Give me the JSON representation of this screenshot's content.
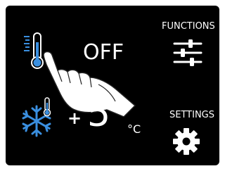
{
  "display": {
    "status": "OFF",
    "temperature": {
      "sign": "+",
      "value": "5",
      "unit": "°C"
    }
  },
  "menu": {
    "functions_label": "FUNCTIONS",
    "settings_label": "SETTINGS"
  },
  "icons": {
    "thermometer": "thermometer-icon",
    "snowflake": "snowflake-icon",
    "sliders": "sliders-icon",
    "gear": "gear-icon",
    "hand": "pointing-hand-icon"
  },
  "colors": {
    "background": "#000000",
    "foreground": "#ffffff",
    "accent": "#3a8fe0"
  }
}
